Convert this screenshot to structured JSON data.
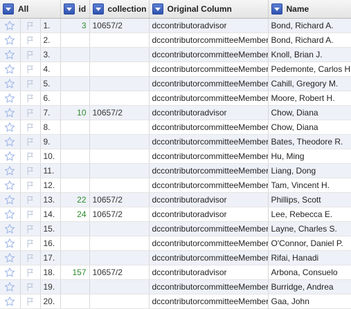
{
  "headers": {
    "all": "All",
    "id": "id",
    "collection": "collection",
    "original_column": "Original Column",
    "name": "Name"
  },
  "icons": {
    "star": "star-icon",
    "flag": "flag-icon",
    "column_menu": "chevron-down-icon"
  },
  "colors": {
    "star": "#9fb6e8",
    "id_text": "#2e8b2e",
    "odd_row": "#eef1f8",
    "menu_button": "#3a5ec0"
  },
  "rows": [
    {
      "num": "1.",
      "id": "3",
      "collection": "10657/2",
      "original_column": "dccontributoradvisor",
      "name": "Bond, Richard A."
    },
    {
      "num": "2.",
      "id": "",
      "collection": "",
      "original_column": "dccontributorcommitteeMember",
      "name": "Bond, Richard A."
    },
    {
      "num": "3.",
      "id": "",
      "collection": "",
      "original_column": "dccontributorcommitteeMember",
      "name": "Knoll, Brian J."
    },
    {
      "num": "4.",
      "id": "",
      "collection": "",
      "original_column": "dccontributorcommitteeMember",
      "name": "Pedemonte, Carlos H."
    },
    {
      "num": "5.",
      "id": "",
      "collection": "",
      "original_column": "dccontributorcommitteeMember",
      "name": "Cahill, Gregory M."
    },
    {
      "num": "6.",
      "id": "",
      "collection": "",
      "original_column": "dccontributorcommitteeMember",
      "name": "Moore, Robert H."
    },
    {
      "num": "7.",
      "id": "10",
      "collection": "10657/2",
      "original_column": "dccontributoradvisor",
      "name": "Chow, Diana"
    },
    {
      "num": "8.",
      "id": "",
      "collection": "",
      "original_column": "dccontributorcommitteeMember",
      "name": "Chow, Diana"
    },
    {
      "num": "9.",
      "id": "",
      "collection": "",
      "original_column": "dccontributorcommitteeMember",
      "name": "Bates, Theodore R."
    },
    {
      "num": "10.",
      "id": "",
      "collection": "",
      "original_column": "dccontributorcommitteeMember",
      "name": "Hu, Ming"
    },
    {
      "num": "11.",
      "id": "",
      "collection": "",
      "original_column": "dccontributorcommitteeMember",
      "name": "Liang, Dong"
    },
    {
      "num": "12.",
      "id": "",
      "collection": "",
      "original_column": "dccontributorcommitteeMember",
      "name": "Tam, Vincent H."
    },
    {
      "num": "13.",
      "id": "22",
      "collection": "10657/2",
      "original_column": "dccontributoradvisor",
      "name": "Phillips, Scott"
    },
    {
      "num": "14.",
      "id": "24",
      "collection": "10657/2",
      "original_column": "dccontributoradvisor",
      "name": "Lee, Rebecca E."
    },
    {
      "num": "15.",
      "id": "",
      "collection": "",
      "original_column": "dccontributorcommitteeMember",
      "name": "Layne, Charles S."
    },
    {
      "num": "16.",
      "id": "",
      "collection": "",
      "original_column": "dccontributorcommitteeMember",
      "name": "O'Connor, Daniel P."
    },
    {
      "num": "17.",
      "id": "",
      "collection": "",
      "original_column": "dccontributorcommitteeMember",
      "name": "Rifai, Hanadi"
    },
    {
      "num": "18.",
      "id": "157",
      "collection": "10657/2",
      "original_column": "dccontributoradvisor",
      "name": "Arbona, Consuelo"
    },
    {
      "num": "19.",
      "id": "",
      "collection": "",
      "original_column": "dccontributorcommitteeMember",
      "name": "Burridge, Andrea"
    },
    {
      "num": "20.",
      "id": "",
      "collection": "",
      "original_column": "dccontributorcommitteeMember",
      "name": "Gaa, John"
    }
  ]
}
